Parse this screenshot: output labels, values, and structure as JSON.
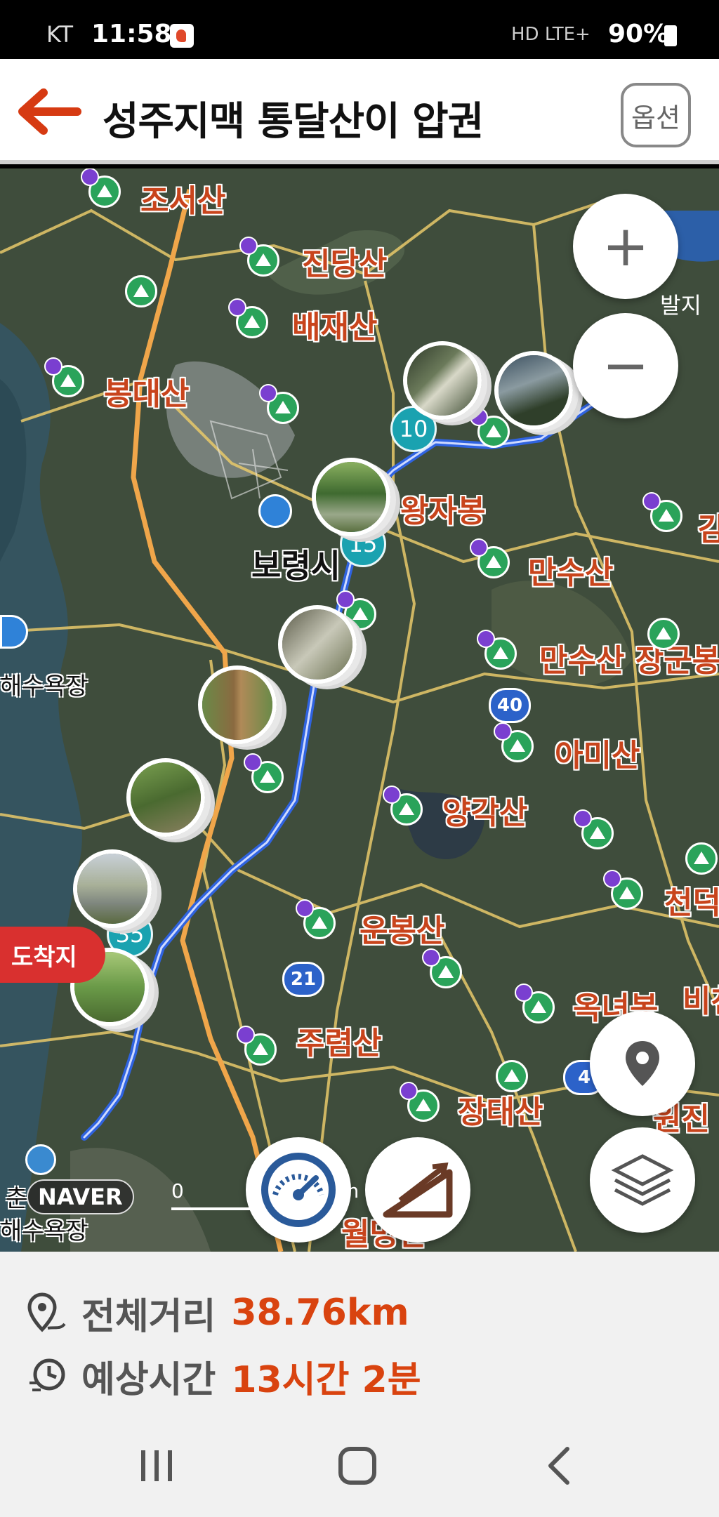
{
  "status_bar": {
    "carrier": "KT",
    "time": "11:58",
    "network": "HD LTE+",
    "battery": "90%"
  },
  "header": {
    "title": "성주지맥 통달산이 압권",
    "options_label": "옵션"
  },
  "map": {
    "place_labels": [
      "조서산",
      "진당산",
      "배재산",
      "봉대산",
      "왕자봉",
      "만수산",
      "만수산 장군봉",
      "아미산",
      "양각산",
      "운봉산",
      "주렴산",
      "장태산",
      "옥녀봉",
      "비천",
      "천덕",
      "원진",
      "월명산",
      "감"
    ],
    "city_label": "보령시",
    "beach_labels": [
      "해수욕장",
      "해수욕장",
      "춘"
    ],
    "km_markers": [
      "10",
      "15",
      "35"
    ],
    "route_badges": [
      "40",
      "21",
      "4"
    ],
    "lake_label": "발지",
    "arrival_label": "도착지",
    "logo": "NAVER",
    "scale_zero": "0",
    "scale_unit": "m",
    "zoom_in": "+",
    "zoom_out": "−"
  },
  "info": {
    "distance_label": "전체거리",
    "distance_value": "38.76km",
    "time_label": "예상시간",
    "time_value": "13시간 2분"
  },
  "colors": {
    "accent": "#d9430f",
    "back_arrow": "#d63a12",
    "route": "#2f63e0",
    "mountain": "#2aa35a"
  }
}
